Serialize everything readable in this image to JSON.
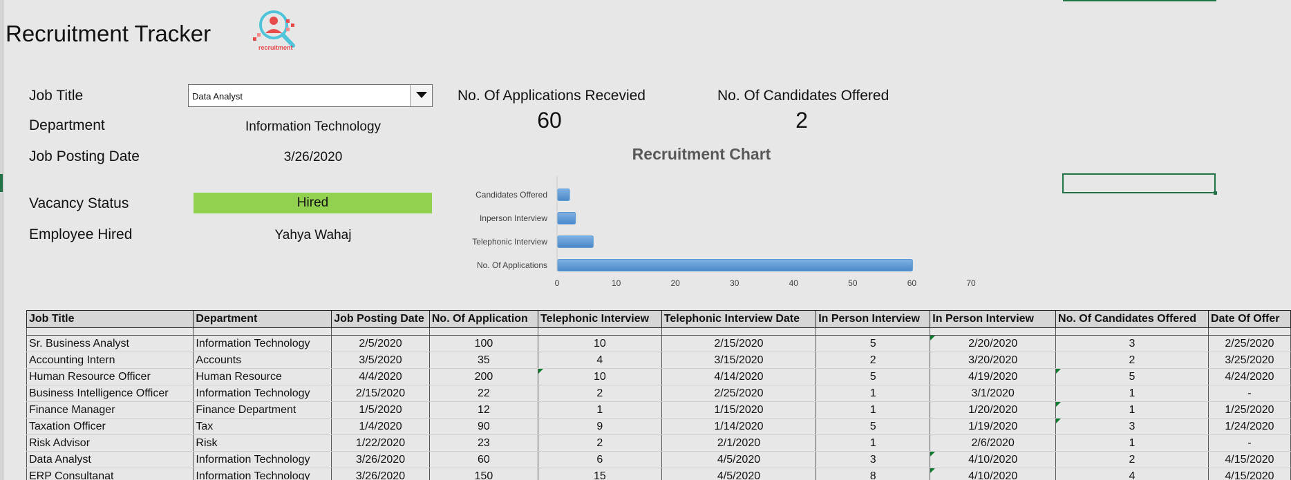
{
  "app": {
    "title": "Recruitment Tracker",
    "logo_text": "recruitment",
    "accent_color": "#217346"
  },
  "form": {
    "job_title_label": "Job Title",
    "job_title_value": "Data Analyst",
    "department_label": "Department",
    "department_value": "Information Technology",
    "posting_date_label": "Job Posting Date",
    "posting_date_value": "3/26/2020",
    "vacancy_status_label": "Vacancy Status",
    "vacancy_status_value": "Hired",
    "vacancy_status_color": "#92d050",
    "employee_hired_label": "Employee Hired",
    "employee_hired_value": "Yahya Wahaj"
  },
  "kpis": {
    "applications_label": "No. Of Applications Recevied",
    "applications_value": "60",
    "offered_label": "No. Of Candidates Offered",
    "offered_value": "2"
  },
  "chart_data": {
    "type": "bar",
    "orientation": "horizontal",
    "title": "Recruitment Chart",
    "categories": [
      "Candidates Offered",
      "Inperson Interview",
      "Telephonic Interview",
      "No. Of Applications"
    ],
    "values": [
      2,
      3,
      6,
      60
    ],
    "xlim": [
      0,
      70
    ],
    "xticks": [
      0,
      10,
      20,
      30,
      40,
      50,
      60,
      70
    ],
    "bar_color": "#5b9bd5",
    "grid": false,
    "legend": "none"
  },
  "table": {
    "columns": [
      "Job Title",
      "Department",
      "Job Posting Date",
      "No. Of Application",
      "Telephonic Interview",
      "Telephonic Interview Date",
      "In Person Interview",
      "In Person Interview",
      "No. Of Candidates Offered",
      "Date Of Offer"
    ],
    "rows": [
      [
        "Sr. Business Analyst",
        "Information Technology",
        "2/5/2020",
        "100",
        "10",
        "2/15/2020",
        "5",
        "2/20/2020",
        "3",
        "2/25/2020"
      ],
      [
        "Accounting Intern",
        "Accounts",
        "3/5/2020",
        "35",
        "4",
        "3/15/2020",
        "2",
        "3/20/2020",
        "2",
        "3/25/2020"
      ],
      [
        "Human Resource Officer",
        "Human Resource",
        "4/4/2020",
        "200",
        "10",
        "4/14/2020",
        "5",
        "4/19/2020",
        "5",
        "4/24/2020"
      ],
      [
        "Business Intelligence Officer",
        "Information Technology",
        "2/15/2020",
        "22",
        "2",
        "2/25/2020",
        "1",
        "3/1/2020",
        "1",
        "-"
      ],
      [
        "Finance Manager",
        "Finance Department",
        "1/5/2020",
        "12",
        "1",
        "1/15/2020",
        "1",
        "1/20/2020",
        "1",
        "1/25/2020"
      ],
      [
        "Taxation Officer",
        "Tax",
        "1/4/2020",
        "90",
        "9",
        "1/14/2020",
        "5",
        "1/19/2020",
        "3",
        "1/24/2020"
      ],
      [
        "Risk Advisor",
        "Risk",
        "1/22/2020",
        "23",
        "2",
        "2/1/2020",
        "1",
        "2/6/2020",
        "1",
        "-"
      ],
      [
        "Data Analyst",
        "Information Technology",
        "3/26/2020",
        "60",
        "6",
        "4/5/2020",
        "3",
        "4/10/2020",
        "2",
        "4/15/2020"
      ],
      [
        "ERP Consultanat",
        "Information Technology",
        "3/26/2020",
        "150",
        "15",
        "4/5/2020",
        "8",
        "4/10/2020",
        "4",
        "4/15/2020"
      ]
    ]
  }
}
